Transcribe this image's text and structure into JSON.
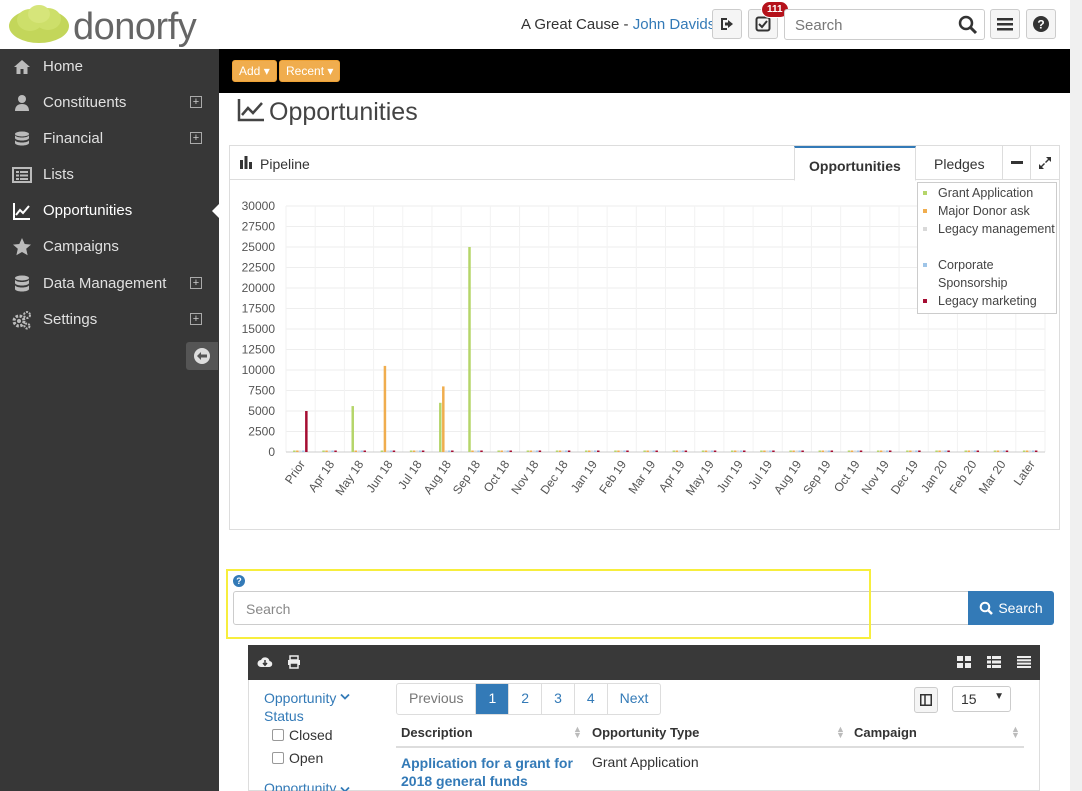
{
  "header": {
    "logo_text": "donorfy",
    "org_name": "A Great Cause",
    "separator": " - ",
    "user_name": "John Davids",
    "tasks_badge": "111",
    "search_placeholder": "Search"
  },
  "sidebar": {
    "items": [
      {
        "label": "Home",
        "icon": "home-icon",
        "expandable": false
      },
      {
        "label": "Constituents",
        "icon": "user-icon",
        "expandable": true
      },
      {
        "label": "Financial",
        "icon": "coins-icon",
        "expandable": true
      },
      {
        "label": "Lists",
        "icon": "list-icon",
        "expandable": false
      },
      {
        "label": "Opportunities",
        "icon": "line-chart-icon",
        "expandable": false,
        "active": true
      },
      {
        "label": "Campaigns",
        "icon": "star-icon",
        "expandable": false
      },
      {
        "label": "Data Management",
        "icon": "database-icon",
        "expandable": true
      },
      {
        "label": "Settings",
        "icon": "gears-icon",
        "expandable": true
      }
    ]
  },
  "toolbar": {
    "add_label": "Add",
    "recent_label": "Recent"
  },
  "page": {
    "title": "Opportunities"
  },
  "panel": {
    "title": "Pipeline",
    "tabs": [
      "Opportunities",
      "Pledges"
    ],
    "active_tab": "Opportunities"
  },
  "chart_data": {
    "type": "bar",
    "categories": [
      "Prior",
      "Apr 18",
      "May 18",
      "Jun 18",
      "Jul 18",
      "Aug 18",
      "Sep 18",
      "Oct 18",
      "Nov 18",
      "Dec 18",
      "Jan 19",
      "Feb 19",
      "Mar 19",
      "Apr 19",
      "May 19",
      "Jun 19",
      "Jul 19",
      "Aug 19",
      "Sep 19",
      "Oct 19",
      "Nov 19",
      "Dec 19",
      "Jan 20",
      "Feb 20",
      "Mar 20",
      "Later"
    ],
    "series": [
      {
        "name": "Grant Application",
        "color": "#b5d56a",
        "values": [
          0,
          0,
          5600,
          0,
          0,
          6000,
          25000,
          0,
          0,
          0,
          0,
          0,
          0,
          0,
          0,
          0,
          0,
          0,
          0,
          0,
          0,
          0,
          0,
          0,
          0,
          0
        ]
      },
      {
        "name": "Major Donor ask",
        "color": "#f0ad4e",
        "values": [
          0,
          0,
          0,
          10500,
          0,
          8000,
          0,
          0,
          0,
          0,
          0,
          0,
          0,
          0,
          0,
          0,
          0,
          0,
          0,
          0,
          0,
          0,
          0,
          0,
          0,
          0
        ]
      },
      {
        "name": "Legacy management",
        "color": "#d9d9d9",
        "values": [
          0,
          0,
          0,
          0,
          0,
          0,
          0,
          0,
          0,
          0,
          0,
          0,
          0,
          0,
          0,
          0,
          0,
          0,
          0,
          0,
          0,
          0,
          0,
          0,
          0,
          0
        ]
      },
      {
        "name": "Corporate Sponsorship",
        "color": "#9fc5e8",
        "values": [
          0,
          0,
          0,
          0,
          0,
          0,
          0,
          0,
          0,
          0,
          0,
          0,
          0,
          0,
          0,
          0,
          0,
          0,
          0,
          0,
          0,
          0,
          0,
          0,
          0,
          0
        ]
      },
      {
        "name": "Legacy marketing",
        "color": "#a50d32",
        "values": [
          5000,
          0,
          0,
          0,
          0,
          0,
          0,
          0,
          0,
          0,
          0,
          0,
          0,
          0,
          0,
          0,
          0,
          0,
          0,
          0,
          0,
          0,
          0,
          0,
          0,
          0
        ]
      }
    ],
    "ylim": [
      0,
      30000
    ],
    "yticks": [
      "30000",
      "27500",
      "25000",
      "22500",
      "20000",
      "17500",
      "15000",
      "12500",
      "10000",
      "7500",
      "5000",
      "2500",
      "0"
    ],
    "grid": true,
    "legend": "top-right"
  },
  "search": {
    "placeholder": "Search",
    "button_label": "Search"
  },
  "filters": {
    "group1_title": "Opportunity Status",
    "options": [
      "Closed",
      "Open"
    ],
    "group2_title": "Opportunity"
  },
  "pagination": {
    "prev": "Previous",
    "pages": [
      "1",
      "2",
      "3",
      "4"
    ],
    "next": "Next",
    "page_size": "15"
  },
  "table": {
    "columns": [
      "Description",
      "Opportunity Type",
      "Campaign"
    ],
    "rows": [
      {
        "description": "Application for a grant for 2018 general funds",
        "type": "Grant Application",
        "campaign": ""
      }
    ]
  }
}
